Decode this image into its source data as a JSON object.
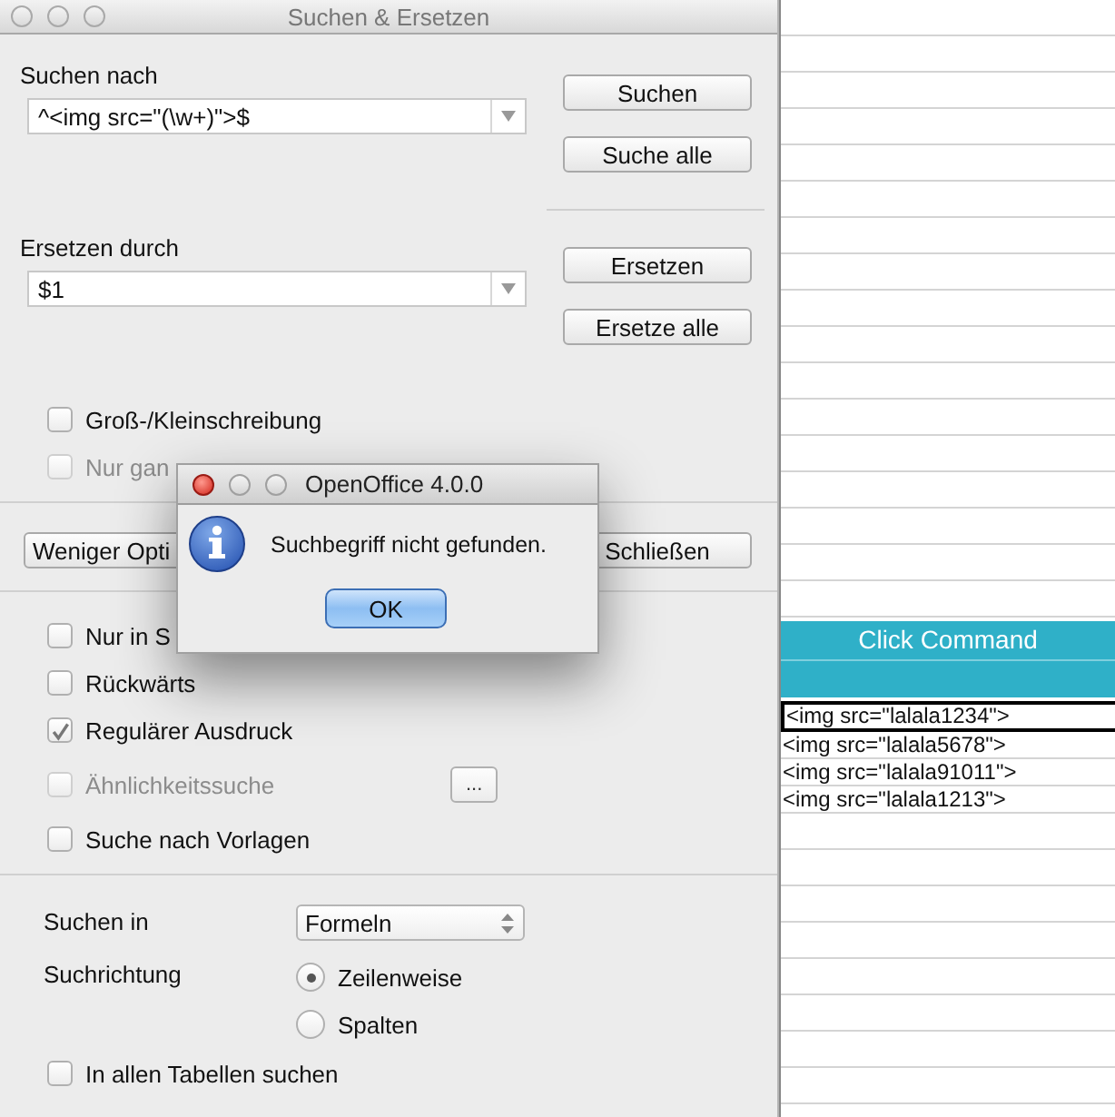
{
  "window": {
    "title": "Suchen & Ersetzen"
  },
  "search": {
    "label": "Suchen nach",
    "value": "^<img src=\"(\\w+)\">$"
  },
  "search_buttons": [
    "Suchen",
    "Suche alle"
  ],
  "replace": {
    "label": "Ersetzen durch",
    "value": "$1"
  },
  "replace_buttons": [
    "Ersetzen",
    "Ersetze alle"
  ],
  "options_top": [
    {
      "label": "Groß-/Kleinschreibung",
      "checked": false,
      "disabled": false
    },
    {
      "label": "Nur gan",
      "checked": false,
      "disabled": true
    }
  ],
  "less_options_button": "Weniger Opti",
  "close_button": "Schließen",
  "options": [
    {
      "label": "Nur in S",
      "checked": false,
      "disabled": false
    },
    {
      "label": "Rückwärts",
      "checked": false,
      "disabled": false
    },
    {
      "label": "Regulärer Ausdruck",
      "checked": true,
      "disabled": false
    },
    {
      "label": "Ähnlichkeitssuche",
      "checked": false,
      "disabled": true,
      "button": "..."
    },
    {
      "label": "Suche nach Vorlagen",
      "checked": false,
      "disabled": false
    }
  ],
  "search_in": {
    "label": "Suchen in",
    "value": "Formeln"
  },
  "direction": {
    "label": "Suchrichtung",
    "options": [
      {
        "label": "Zeilenweise",
        "selected": true
      },
      {
        "label": "Spalten",
        "selected": false
      }
    ]
  },
  "all_sheets": {
    "label": "In allen Tabellen suchen",
    "checked": false
  },
  "alert": {
    "title": "OpenOffice 4.0.0",
    "message": "Suchbegriff nicht gefunden.",
    "button": "OK"
  },
  "sheet": {
    "header": "Click Command",
    "rows": [
      {
        "text": "<img src=\"lalala1234\">",
        "selected": true
      },
      {
        "text": "<img src=\"lalala5678\">",
        "selected": false
      },
      {
        "text": "<img src=\"lalala91011\">",
        "selected": false
      },
      {
        "text": "<img src=\"lalala1213\">",
        "selected": false
      }
    ]
  }
}
